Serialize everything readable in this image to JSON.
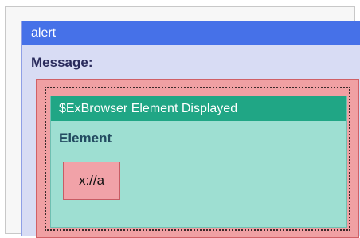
{
  "alert": {
    "title": "alert",
    "message_label": "Message:",
    "message": {
      "block_title": "$ExBrowser Element Displayed",
      "element_label": "Element",
      "element_value": "x://a"
    }
  },
  "colors": {
    "alert_header": "#4671e8",
    "alert_body": "#d8dcf4",
    "message_container": "#f0a0a3",
    "browser_header": "#20a685",
    "browser_body": "#9edfd2",
    "value_box": "#f1a2a8"
  }
}
